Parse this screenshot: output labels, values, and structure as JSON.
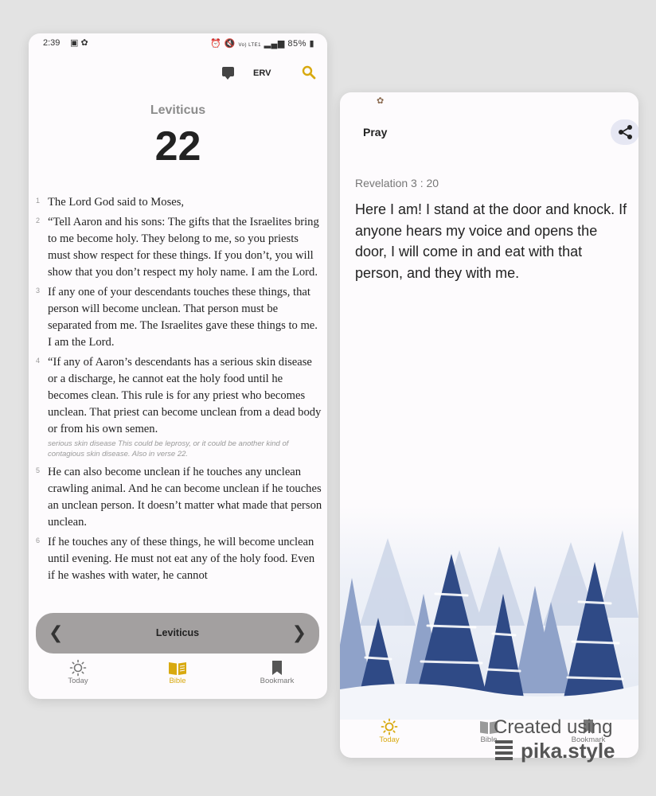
{
  "left_phone": {
    "status_bar": {
      "time": "2:39",
      "indicators": "Vo) LTE1",
      "battery": "85%"
    },
    "topbar": {
      "version": "ERV"
    },
    "book": "Leviticus",
    "chapter": "22",
    "verses": [
      {
        "num": "1",
        "text": "The Lord God said to Moses,"
      },
      {
        "num": "2",
        "text": "“Tell Aaron and his sons: The gifts that the Israelites bring to me become holy. They belong to me, so you priests must show respect for these things. If you don’t, you will show that you don’t respect my holy name. I am the Lord."
      },
      {
        "num": "3",
        "text": "If any one of your descendants touches these things, that person will become unclean. That person must be separated from me. The Israelites gave these things to me. I am the Lord."
      },
      {
        "num": "4",
        "text": "“If any of Aaron’s descendants has a serious skin disease or a discharge, he cannot eat the holy food until he becomes clean. This rule is for any priest who becomes unclean. That priest can become unclean from a dead body or from his own semen."
      },
      {
        "num": "5",
        "text": "He can also become unclean if he touches any unclean crawling animal. And he can become unclean if he touches an unclean person. It doesn’t matter what made that person unclean."
      },
      {
        "num": "6",
        "text": "If he touches any of these things, he will become unclean until evening. He must not eat any of the holy food. Even if he washes with water, he cannot"
      }
    ],
    "footnote": "serious skin disease This could be leprosy, or it could be another kind of contagious skin disease. Also in verse 22.",
    "nav_bar": {
      "label": "Leviticus"
    },
    "bottom_nav": [
      {
        "label": "Today",
        "icon": "sun-icon",
        "active": false
      },
      {
        "label": "Bible",
        "icon": "book-open-icon",
        "active": true
      },
      {
        "label": "Bookmark",
        "icon": "bookmark-icon",
        "active": false
      }
    ]
  },
  "right_phone": {
    "title": "Pray",
    "verse_reference": "Revelation 3 : 20",
    "verse_text": "Here I am! I stand at the door and knock. If anyone hears my voice and opens the door, I will come in and eat with that person, and they with me.",
    "bottom_nav": [
      {
        "label": "Today",
        "icon": "sun-icon",
        "active": true
      },
      {
        "label": "Bible",
        "icon": "book-open-icon",
        "active": false
      },
      {
        "label": "Bookmark",
        "icon": "bookmark-icon",
        "active": false
      }
    ]
  },
  "watermark": {
    "line1": "Created using",
    "line2": "pika.style"
  },
  "colors": {
    "accent": "#d8a90f",
    "nav_bar_bg": "#a3a0a0",
    "share_bg": "#e6e7f3"
  }
}
